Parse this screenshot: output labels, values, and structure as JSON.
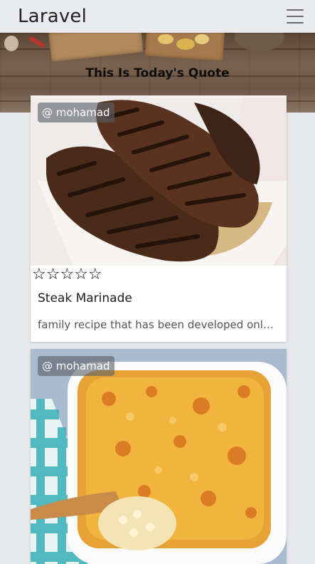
{
  "navbar": {
    "brand": "Laravel",
    "menu_icon": "hamburger-icon"
  },
  "hero": {
    "quote_title": "This Is Today's Quote"
  },
  "recipes": [
    {
      "author": "@ mohamad",
      "rating_icons": [
        "star-outline-icon",
        "star-outline-icon",
        "star-outline-icon",
        "star-outline-icon",
        "star-outline-icon"
      ],
      "stars": "☆☆☆☆☆",
      "rating_value": 0,
      "rating_max": 5,
      "title": "Steak Marinade",
      "description": "family recipe that has been developed only ..."
    },
    {
      "author": "@ mohamad"
    }
  ],
  "colors": {
    "background": "#e6e8ec",
    "card": "#ffffff",
    "badge": "#5a5f69"
  }
}
